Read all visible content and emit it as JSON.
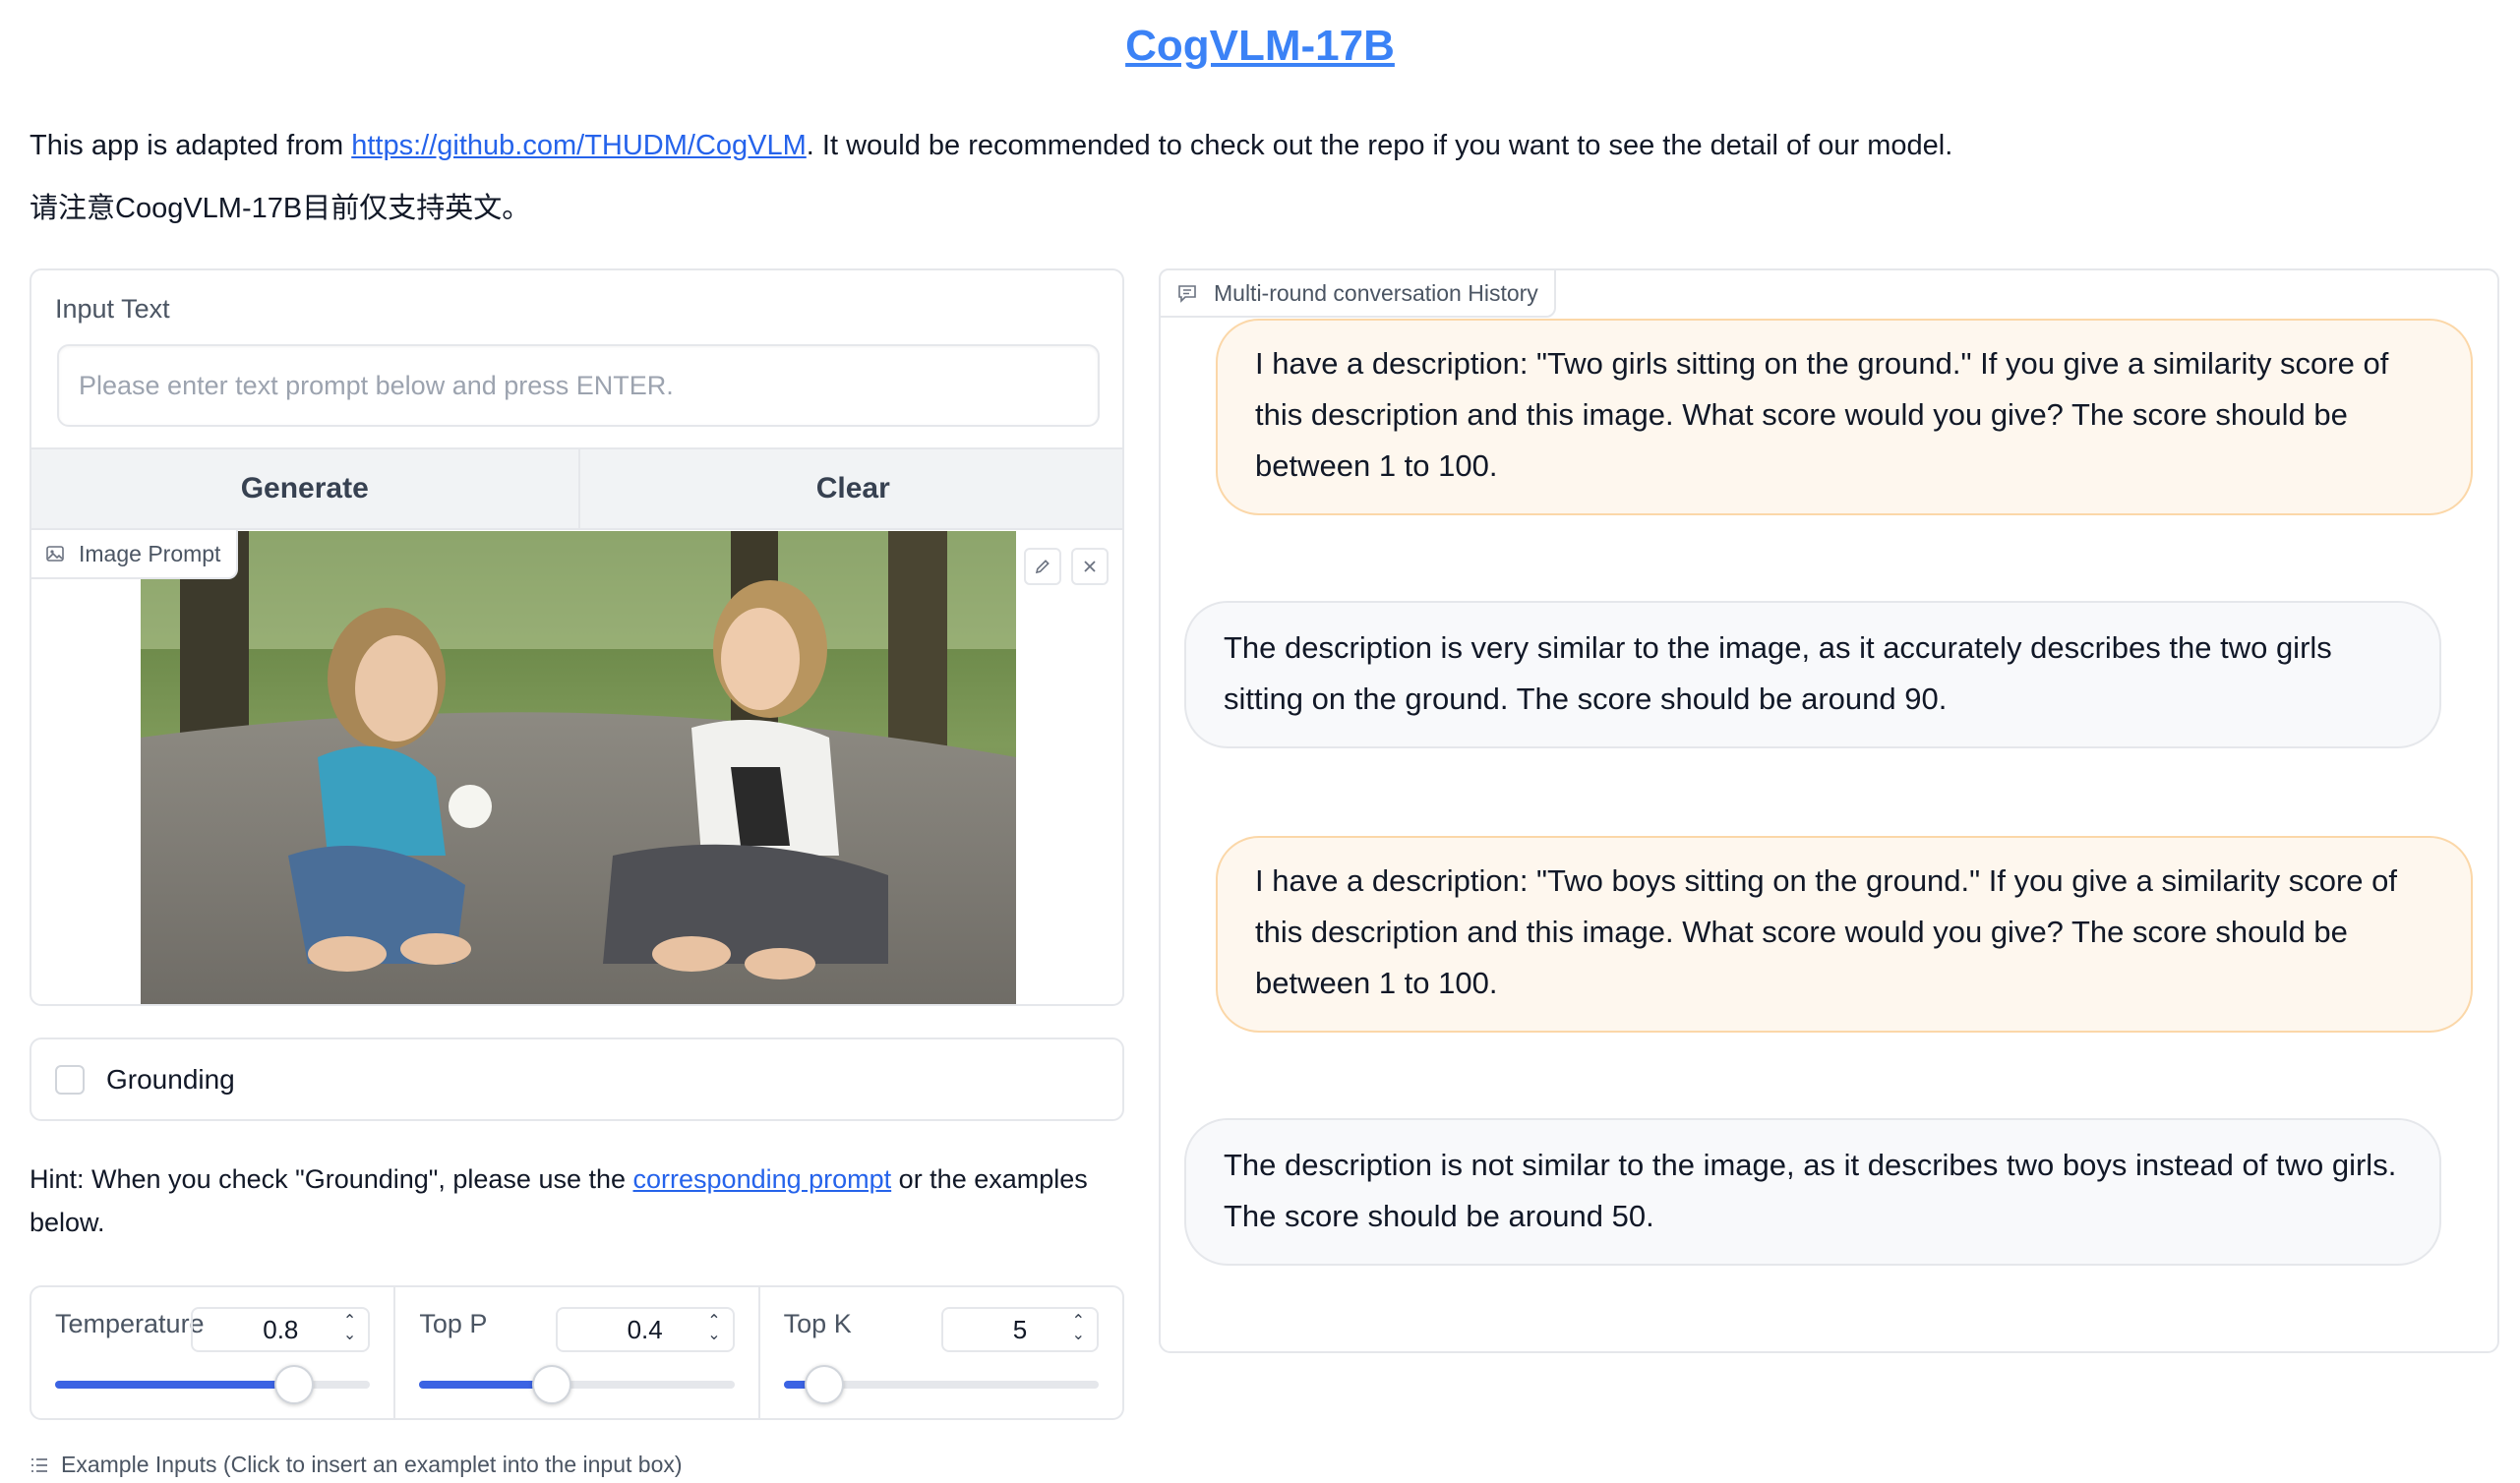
{
  "header": {
    "title": "CogVLM-17B",
    "intro_prefix": "This app is adapted from ",
    "intro_link": "https://github.com/THUDM/CogVLM",
    "intro_suffix": ". It would be recommended to check out the repo if you want to see the detail of our model.",
    "note": "请注意CoogVLM-17B目前仅支持英文。"
  },
  "input": {
    "label": "Input Text",
    "placeholder": "Please enter text prompt below and press ENTER.",
    "value": ""
  },
  "buttons": {
    "generate": "Generate",
    "clear": "Clear"
  },
  "image_prompt": {
    "label": "Image Prompt",
    "icon": "image-icon"
  },
  "grounding": {
    "label": "Grounding",
    "checked": false
  },
  "hint": {
    "prefix": "Hint: When you check \"Grounding\", please use the ",
    "link": "corresponding prompt",
    "suffix": " or the examples below."
  },
  "params": [
    {
      "label": "Temperature",
      "value": "0.8",
      "level": 0.76
    },
    {
      "label": "Top P",
      "value": "0.4",
      "level": 0.42
    },
    {
      "label": "Top K",
      "value": "5",
      "level": 0.13
    }
  ],
  "examples_label": "Example Inputs (Click to insert an examplet into the input box)",
  "chat": {
    "tab_label": "Multi-round conversation History",
    "messages": [
      {
        "role": "user",
        "text": "I have a description: \"Two girls sitting on the ground.\" If you give a similarity score of this description and this image. What score would you give? The score should be between 1 to 100."
      },
      {
        "role": "bot",
        "text": "The description is very similar to the image, as it accurately describes the two girls sitting on the ground. The score should be around 90."
      },
      {
        "role": "user",
        "text": "I have a description: \"Two boys sitting on the ground.\" If you give a similarity score of this description and this image. What score would you give? The score should be between 1 to 100."
      },
      {
        "role": "bot",
        "text": "The description is not similar to the image, as it describes two boys instead of two girls. The score should be around 50."
      }
    ]
  },
  "colors": {
    "accent": "#3b63e3",
    "link": "#2563eb",
    "user_bubble": "#fef7ee",
    "bot_bubble": "#f8f9fb"
  }
}
